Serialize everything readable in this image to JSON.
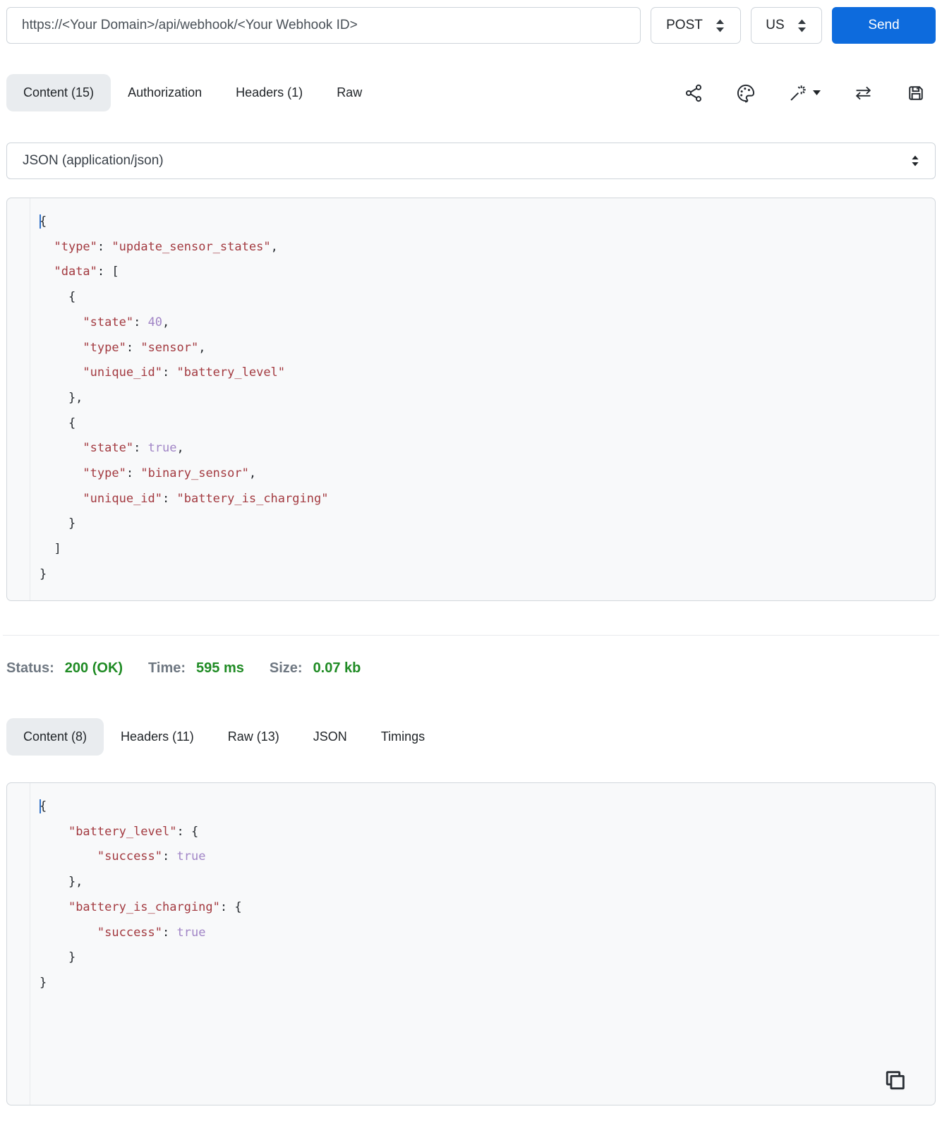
{
  "request_bar": {
    "url": "https://<Your Domain>/api/webhook/<Your Webhook ID>",
    "method": "POST",
    "region": "US",
    "send_label": "Send"
  },
  "request_tabs": [
    {
      "label": "Content (15)"
    },
    {
      "label": "Authorization"
    },
    {
      "label": "Headers (1)"
    },
    {
      "label": "Raw"
    }
  ],
  "toolbar_icons": [
    "share-icon",
    "palette-icon",
    "magic-wand-icon",
    "transfer-icon",
    "save-icon"
  ],
  "content_type": {
    "selected": "JSON (application/json)"
  },
  "request_body": {
    "lines": [
      [
        [
          "pc",
          "{"
        ]
      ],
      [
        [
          "p",
          "  "
        ],
        [
          "s",
          "\"type\""
        ],
        [
          "p",
          ": "
        ],
        [
          "s",
          "\"update_sensor_states\""
        ],
        [
          "p",
          ","
        ]
      ],
      [
        [
          "p",
          "  "
        ],
        [
          "s",
          "\"data\""
        ],
        [
          "p",
          ": ["
        ]
      ],
      [
        [
          "p",
          "    {"
        ]
      ],
      [
        [
          "p",
          "      "
        ],
        [
          "s",
          "\"state\""
        ],
        [
          "p",
          ": "
        ],
        [
          "n",
          "40"
        ],
        [
          "p",
          ","
        ]
      ],
      [
        [
          "p",
          "      "
        ],
        [
          "s",
          "\"type\""
        ],
        [
          "p",
          ": "
        ],
        [
          "s",
          "\"sensor\""
        ],
        [
          "p",
          ","
        ]
      ],
      [
        [
          "p",
          "      "
        ],
        [
          "s",
          "\"unique_id\""
        ],
        [
          "p",
          ": "
        ],
        [
          "s",
          "\"battery_level\""
        ]
      ],
      [
        [
          "p",
          "    },"
        ]
      ],
      [
        [
          "p",
          "    {"
        ]
      ],
      [
        [
          "p",
          "      "
        ],
        [
          "s",
          "\"state\""
        ],
        [
          "p",
          ": "
        ],
        [
          "n",
          "true"
        ],
        [
          "p",
          ","
        ]
      ],
      [
        [
          "p",
          "      "
        ],
        [
          "s",
          "\"type\""
        ],
        [
          "p",
          ": "
        ],
        [
          "s",
          "\"binary_sensor\""
        ],
        [
          "p",
          ","
        ]
      ],
      [
        [
          "p",
          "      "
        ],
        [
          "s",
          "\"unique_id\""
        ],
        [
          "p",
          ": "
        ],
        [
          "s",
          "\"battery_is_charging\""
        ]
      ],
      [
        [
          "p",
          "    }"
        ]
      ],
      [
        [
          "p",
          "  ]"
        ]
      ],
      [
        [
          "p",
          "}"
        ]
      ]
    ]
  },
  "status_bar": {
    "status_label": "Status:",
    "status_value": "200 (OK)",
    "time_label": "Time:",
    "time_value": "595 ms",
    "size_label": "Size:",
    "size_value": "0.07 kb"
  },
  "response_tabs": [
    {
      "label": "Content (8)"
    },
    {
      "label": "Headers (11)"
    },
    {
      "label": "Raw (13)"
    },
    {
      "label": "JSON"
    },
    {
      "label": "Timings"
    }
  ],
  "response_body": {
    "lines": [
      [
        [
          "pc",
          "{"
        ]
      ],
      [
        [
          "p",
          "    "
        ],
        [
          "s",
          "\"battery_level\""
        ],
        [
          "p",
          ": {"
        ]
      ],
      [
        [
          "p",
          "        "
        ],
        [
          "s",
          "\"success\""
        ],
        [
          "p",
          ": "
        ],
        [
          "n",
          "true"
        ]
      ],
      [
        [
          "p",
          "    },"
        ]
      ],
      [
        [
          "p",
          "    "
        ],
        [
          "s",
          "\"battery_is_charging\""
        ],
        [
          "p",
          ": {"
        ]
      ],
      [
        [
          "p",
          "        "
        ],
        [
          "s",
          "\"success\""
        ],
        [
          "p",
          ": "
        ],
        [
          "n",
          "true"
        ]
      ],
      [
        [
          "p",
          "    }"
        ]
      ],
      [
        [
          "p",
          "}"
        ]
      ]
    ]
  },
  "colors": {
    "accent_blue": "#0d6bdd",
    "success_green": "#1f8b24",
    "code_string_red": "#a33a40",
    "code_atom_purple": "#a185c6",
    "active_tab_bg": "#e9ecef"
  }
}
